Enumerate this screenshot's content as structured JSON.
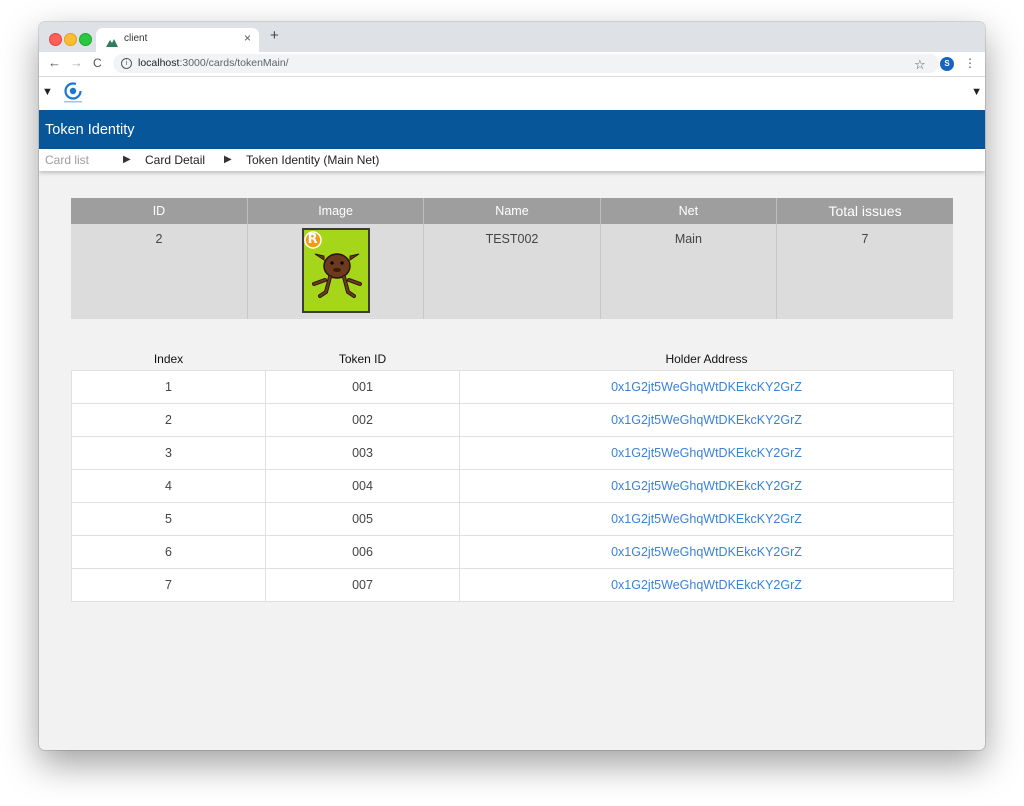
{
  "browser": {
    "tab_title": "client",
    "tab_close": "×",
    "new_tab": "+",
    "url_host": "localhost",
    "url_path": ":3000/cards/tokenMain/",
    "profile_initial": "S"
  },
  "app": {
    "title": "Token Identity",
    "breadcrumb": {
      "card_list": "Card list",
      "card_detail": "Card Detail",
      "current": "Token Identity (Main Net)",
      "separator": "▶"
    }
  },
  "card_table": {
    "headers": [
      "ID",
      "Image",
      "Name",
      "Net",
      "Total issues"
    ],
    "row": {
      "id": "2",
      "image_badge": "R",
      "name": "TEST002",
      "net": "Main",
      "total_issues": "7"
    }
  },
  "token_table": {
    "headers": [
      "Index",
      "Token ID",
      "Holder Address"
    ],
    "rows": [
      {
        "index": "1",
        "token_id": "001",
        "holder": "0x1G2jt5WeGhqWtDKEkcKY2GrZ"
      },
      {
        "index": "2",
        "token_id": "002",
        "holder": "0x1G2jt5WeGhqWtDKEkcKY2GrZ"
      },
      {
        "index": "3",
        "token_id": "003",
        "holder": "0x1G2jt5WeGhqWtDKEkcKY2GrZ"
      },
      {
        "index": "4",
        "token_id": "004",
        "holder": "0x1G2jt5WeGhqWtDKEkcKY2GrZ"
      },
      {
        "index": "5",
        "token_id": "005",
        "holder": "0x1G2jt5WeGhqWtDKEkcKY2GrZ"
      },
      {
        "index": "6",
        "token_id": "006",
        "holder": "0x1G2jt5WeGhqWtDKEkcKY2GrZ"
      },
      {
        "index": "7",
        "token_id": "007",
        "holder": "0x1G2jt5WeGhqWtDKEkcKY2GrZ"
      }
    ]
  },
  "colors": {
    "header_blue": "#07569a",
    "table_header_gray": "#9e9e9e",
    "link_blue": "#3a82d6"
  }
}
